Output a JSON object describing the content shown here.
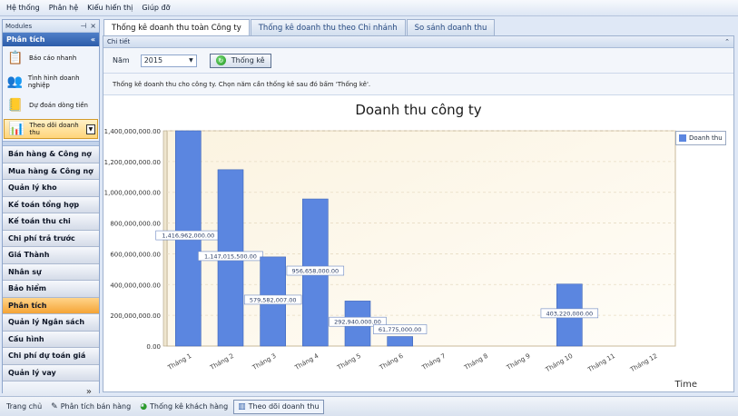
{
  "menu": [
    "Hệ thống",
    "Phân hệ",
    "Kiểu hiển thị",
    "Giúp đỡ"
  ],
  "sidebar": {
    "header": "Modules",
    "group_title": "Phân tích",
    "items": [
      {
        "label": "Báo cáo nhanh",
        "icon": "report-icon"
      },
      {
        "label": "Tình hình doanh nghiệp",
        "icon": "users-icon"
      },
      {
        "label": "Dự đoán dòng tiền",
        "icon": "forecast-icon"
      },
      {
        "label": "Theo dõi doanh thu",
        "icon": "revenue-icon"
      }
    ],
    "nav": [
      "Bán hàng & Công nợ",
      "Mua hàng & Công nợ",
      "Quản lý kho",
      "Kế toán tổng hợp",
      "Kế toán thu chi",
      "Chi phí trả trước",
      "Giá Thành",
      "Nhân sự",
      "Bảo hiểm",
      "Phân tích",
      "Quản lý Ngân sách",
      "Cấu hình",
      "Chi phí dự toán giá",
      "Quản lý vay"
    ],
    "active_nav": "Phân tích",
    "more": "»"
  },
  "tabs": [
    "Thống kê doanh thu toàn Công ty",
    "Thống kê doanh thu theo Chi nhánh",
    "So sánh doanh thu"
  ],
  "panel": {
    "group_title": "Chi tiết",
    "year_label": "Năm",
    "year_value": "2015",
    "button_label": "Thống kê",
    "hint": "Thống kê doanh thu cho công ty. Chọn năm cần thống kê sau đó bấm 'Thống kê'."
  },
  "chart_data": {
    "type": "bar",
    "title": "Doanh thu công ty",
    "xlabel": "Time",
    "ylabel": "",
    "categories": [
      "Tháng 1",
      "Tháng 2",
      "Tháng 3",
      "Tháng 4",
      "Tháng 5",
      "Tháng 6",
      "Tháng 7",
      "Tháng 8",
      "Tháng 9",
      "Tháng 10",
      "Tháng 11",
      "Tháng 12"
    ],
    "series": [
      {
        "name": "Doanh thu",
        "values": [
          1416962000,
          1147015500,
          579582007,
          956658000,
          292940000,
          61775000,
          0,
          0,
          0,
          403220000,
          0,
          0
        ]
      }
    ],
    "data_labels": [
      "1,416,962,000.00",
      "1,147,015,500.00",
      "579,582,007.00",
      "956,658,000.00",
      "292,940,000.00",
      "61,775,000.00",
      "",
      "",
      "",
      "403,220,000.00",
      "",
      ""
    ],
    "ylim": [
      0,
      1400000000
    ],
    "yticks": [
      "0.00",
      "200,000,000.00",
      "400,000,000.00",
      "600,000,000.00",
      "800,000,000.00",
      "1,000,000,000.00",
      "1,200,000,000.00",
      "1,400,000,000.00"
    ],
    "legend": "top-right",
    "bar_color": "#5b86e0"
  },
  "statusbar": [
    {
      "label": "Trang chủ",
      "icon": ""
    },
    {
      "label": "Phân tích bán hàng",
      "icon": "pen-icon"
    },
    {
      "label": "Thống kê khách hàng",
      "icon": "pie-icon"
    },
    {
      "label": "Theo dõi doanh thu",
      "icon": "chart-icon",
      "active": true
    }
  ]
}
